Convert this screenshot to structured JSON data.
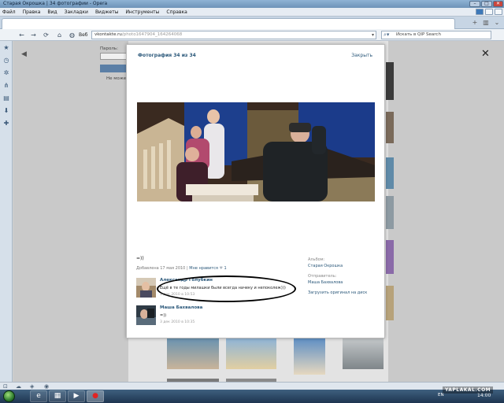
{
  "window": {
    "title": "Старая Окрошка | 34 фотографии - Opera",
    "controls": {
      "minimize": "–",
      "maximize": "□",
      "close": "✕"
    }
  },
  "menu": {
    "items": [
      "Файл",
      "Правка",
      "Вид",
      "Закладки",
      "Виджеты",
      "Инструменты",
      "Справка"
    ]
  },
  "toolbar": {
    "web_label": "Веб",
    "url_domain": "vkontakte.ru",
    "url_path": "/photo1647904_164264068",
    "search_placeholder": "Искать в QIP Search"
  },
  "login": {
    "password_label": "Пароль:",
    "note": "Не может"
  },
  "modal": {
    "title": "Фотография 34 из 34",
    "close_label": "Закрыть",
    "caption": "=))",
    "meta_added": "Добавлена 17 мая 2010",
    "meta_separator": " | ",
    "meta_likes": "Мне нравится",
    "meta_likes_count": "1",
    "album_label": "Альбом:",
    "album_name": "Старая Окрошка",
    "sender_label": "Отправитель:",
    "sender_name": "Маша Бахвалова",
    "download_link": "Загрузить оригинал на диск",
    "comments": [
      {
        "author": "Александр Голубкин",
        "text": "Ещё в те годы милашки были всегда начеку и непоколеж)))",
        "date": "1 дек 2010 в 10:53"
      },
      {
        "author": "Маша Бахвалова",
        "text": "=))",
        "date": "3 дек 2010 в 10:35"
      }
    ]
  },
  "taskbar": {
    "lang": "EN",
    "clock": "14:00"
  },
  "watermark": "YAPLAKAL.COM",
  "colors": {
    "link": "#2b587a",
    "taskbar": "#1e3550",
    "titlebar": "#6d93b8"
  }
}
